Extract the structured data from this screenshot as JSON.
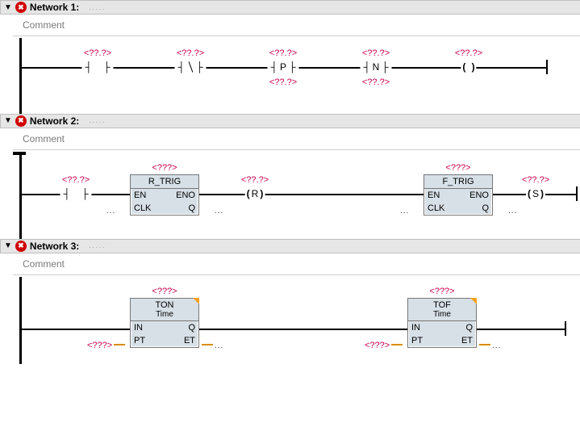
{
  "placeholders": {
    "tag": "<??.?>",
    "inst": "<???>",
    "param": "<???>"
  },
  "labels": {
    "comment": "Comment",
    "dots": ".....",
    "ellipsis": "..."
  },
  "networks": [
    {
      "title": "Network 1:",
      "has_error": true
    },
    {
      "title": "Network 2:",
      "has_error": true
    },
    {
      "title": "Network 3:",
      "has_error": true
    }
  ],
  "nw1": {
    "elements": [
      {
        "kind": "no-contact",
        "tag_top": true
      },
      {
        "kind": "nc-contact",
        "tag_top": true
      },
      {
        "kind": "p-contact",
        "letter": "P",
        "tag_top": true,
        "tag_bottom": true
      },
      {
        "kind": "n-contact",
        "letter": "N",
        "tag_top": true,
        "tag_bottom": true
      },
      {
        "kind": "coil",
        "letter": "",
        "tag_top": true
      }
    ]
  },
  "nw2": {
    "left_contact_tag": true,
    "fb1": {
      "name": "R_TRIG",
      "ports_l": [
        "EN",
        "CLK"
      ],
      "ports_r": [
        "ENO",
        "Q"
      ]
    },
    "mid_coil": {
      "letter": "R",
      "tag_top": true
    },
    "fb2": {
      "name": "F_TRIG",
      "ports_l": [
        "EN",
        "CLK"
      ],
      "ports_r": [
        "ENO",
        "Q"
      ]
    },
    "right_coil": {
      "letter": "S",
      "tag_top": true
    }
  },
  "nw3": {
    "fb1": {
      "name": "TON",
      "sub": "Time",
      "ports_l": [
        "IN",
        "PT"
      ],
      "ports_r": [
        "Q",
        "ET"
      ]
    },
    "fb2": {
      "name": "TOF",
      "sub": "Time",
      "ports_l": [
        "IN",
        "PT"
      ],
      "ports_r": [
        "Q",
        "ET"
      ]
    }
  }
}
